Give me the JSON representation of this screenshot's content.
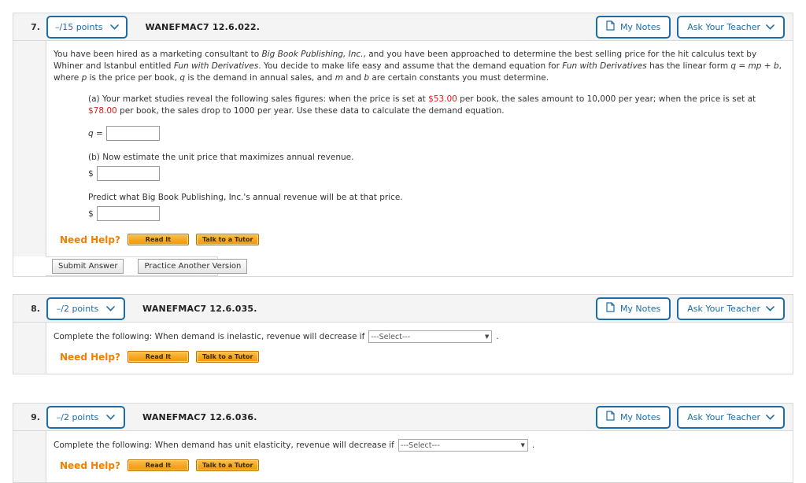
{
  "questions": [
    {
      "number": "7.",
      "points": "–/15 points",
      "code": "WANEFMAC7 12.6.022.",
      "notes_label": "My Notes",
      "teacher_label": "Ask Your Teacher",
      "prose": {
        "s1": "You have been hired as a marketing consultant to ",
        "i1": "Big Book Publishing, Inc.",
        "s2": ", and you have been approached to determine the best selling price for the hit calculus text by Whiner and Istanbul entitled ",
        "i2": "Fun with Derivatives",
        "s3": ". You decide to make life easy and assume that the demand equation for ",
        "i3": "Fun with Derivatives",
        "s4": " has the linear form ",
        "eq": "q = mp + b",
        "s5": ", where ",
        "v1": "p",
        "s6": " is the price per book, ",
        "v2": "q",
        "s7": " is the demand in annual sales, and ",
        "v3": "m",
        "s8": " and ",
        "v4": "b",
        "s9": " are certain constants you must determine."
      },
      "part_a": {
        "t1": "(a) Your market studies reveal the following sales figures: when the price is set at ",
        "p1": "$53.00",
        "t2": " per book, the sales amount to 10,000 per year; when the price is set at ",
        "p2": "$78.00",
        "t3": " per book, the sales drop to 1000 per year. Use these data to calculate the demand equation.",
        "field_label": "q =",
        "field_value": ""
      },
      "part_b": {
        "text": "(b) Now estimate the unit price that maximizes annual revenue.",
        "dollar": "$",
        "field_value": ""
      },
      "part_c": {
        "text": "Predict what Big Book Publishing, Inc.'s annual revenue will be at that price.",
        "dollar": "$",
        "field_value": ""
      },
      "need_help_label": "Need Help?",
      "read_it_label": "Read It",
      "tutor_label": "Talk to a Tutor",
      "submit_label": "Submit Answer",
      "practice_label": "Practice Another Version"
    },
    {
      "number": "8.",
      "points": "–/2 points",
      "code": "WANEFMAC7 12.6.035.",
      "notes_label": "My Notes",
      "teacher_label": "Ask Your Teacher",
      "stem": "Complete the following: When demand is inelastic, revenue will decrease if",
      "select_value": "---Select---",
      "select_options": [
        "---Select---"
      ],
      "period": ".",
      "need_help_label": "Need Help?",
      "read_it_label": "Read It",
      "tutor_label": "Talk to a Tutor"
    },
    {
      "number": "9.",
      "points": "–/2 points",
      "code": "WANEFMAC7 12.6.036.",
      "notes_label": "My Notes",
      "teacher_label": "Ask Your Teacher",
      "stem": "Complete the following: When demand has unit elasticity, revenue will decrease if",
      "select_value": "---Select---",
      "select_options": [
        "---Select---"
      ],
      "period": ".",
      "need_help_label": "Need Help?",
      "read_it_label": "Read It",
      "tutor_label": "Talk to a Tutor"
    }
  ],
  "colors": {
    "accent_blue": "#1b6ca8",
    "help_orange": "#f08000",
    "money_red": "#e01b1b",
    "header_gray": "#f4f4f4"
  }
}
